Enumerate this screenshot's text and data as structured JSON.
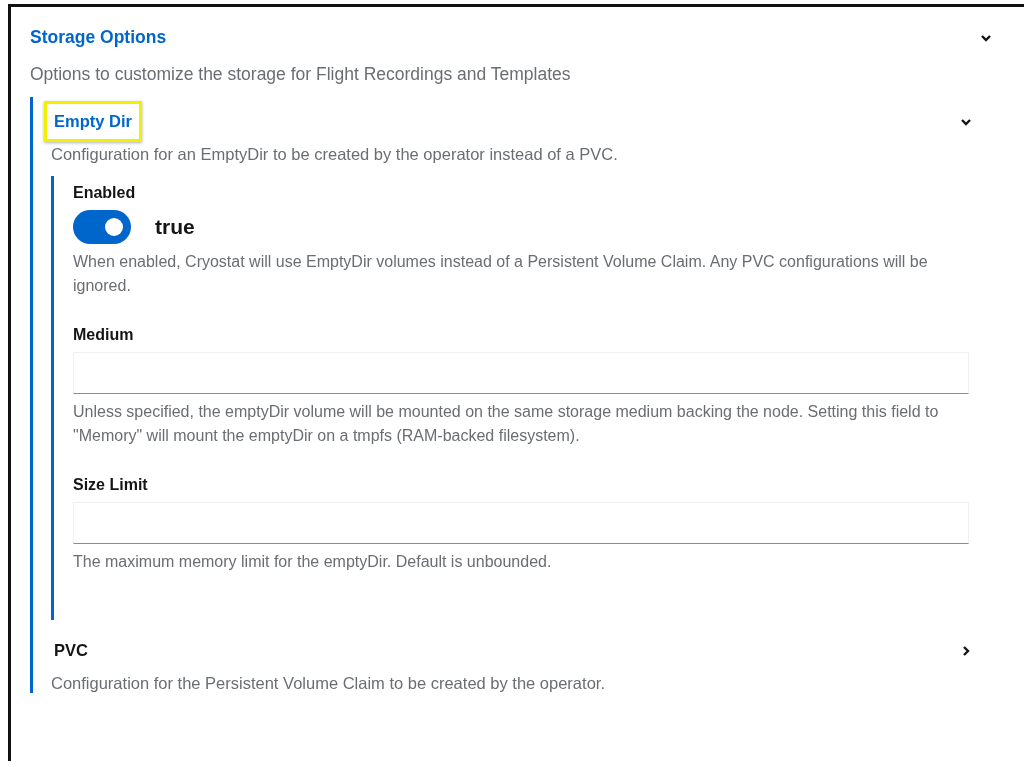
{
  "section": {
    "title": "Storage Options",
    "expanded": true,
    "description": "Options to customize the storage for Flight Recordings and Templates"
  },
  "groups": [
    {
      "title": "Empty Dir",
      "expanded": true,
      "highlighted": true,
      "description": "Configuration for an EmptyDir to be created by the operator instead of a PVC.",
      "fields": [
        {
          "kind": "switch",
          "label": "Enabled",
          "on": true,
          "value_label": "true",
          "helper": "When enabled, Cryostat will use EmptyDir volumes instead of a Persistent Volume Claim. Any PVC configurations will be ignored."
        },
        {
          "kind": "text",
          "label": "Medium",
          "helper": "Unless specified, the emptyDir volume will be mounted on the same storage medium backing the node. Setting this field to \"Memory\" will mount the emptyDir on a tmpfs (RAM-backed filesystem)."
        },
        {
          "kind": "text",
          "label": "Size Limit",
          "helper": "The maximum memory limit for the emptyDir. Default is unbounded."
        }
      ]
    },
    {
      "title": "PVC",
      "expanded": false,
      "highlighted": false,
      "description": "Configuration for the Persistent Volume Claim to be created by the operator."
    }
  ]
}
